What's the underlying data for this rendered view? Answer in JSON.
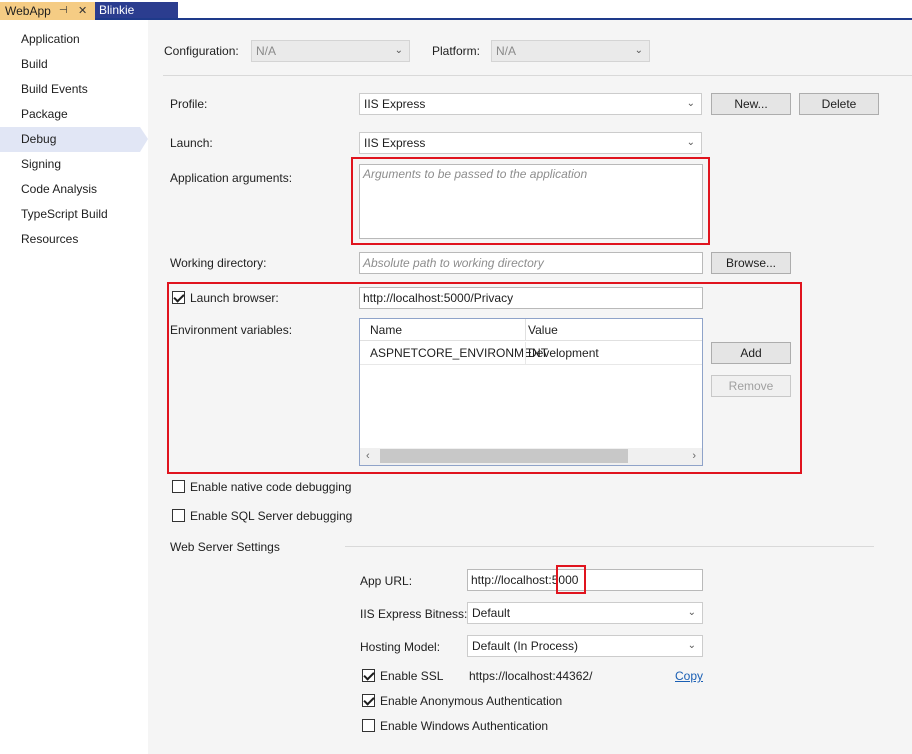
{
  "tabs": [
    {
      "label": "WebApp",
      "active": true
    },
    {
      "label": "Blinkie",
      "active": false
    }
  ],
  "sidebar": {
    "items": [
      {
        "label": "Application"
      },
      {
        "label": "Build"
      },
      {
        "label": "Build Events"
      },
      {
        "label": "Package"
      },
      {
        "label": "Debug",
        "selected": true
      },
      {
        "label": "Signing"
      },
      {
        "label": "Code Analysis"
      },
      {
        "label": "TypeScript Build"
      },
      {
        "label": "Resources"
      }
    ]
  },
  "config": {
    "configuration_label": "Configuration:",
    "configuration_value": "N/A",
    "platform_label": "Platform:",
    "platform_value": "N/A"
  },
  "profile": {
    "label": "Profile:",
    "value": "IIS Express",
    "new_label": "New...",
    "delete_label": "Delete"
  },
  "launch": {
    "label": "Launch:",
    "value": "IIS Express"
  },
  "app_args": {
    "label": "Application arguments:",
    "placeholder": "Arguments to be passed to the application"
  },
  "working_dir": {
    "label": "Working directory:",
    "placeholder": "Absolute path to working directory",
    "browse_label": "Browse..."
  },
  "launch_browser": {
    "label": "Launch browser:",
    "checked": true,
    "url": "http://localhost:5000/Privacy"
  },
  "env": {
    "label": "Environment variables:",
    "columns": [
      "Name",
      "Value"
    ],
    "rows": [
      {
        "name": "ASPNETCORE_ENVIRONMENT",
        "value": "Development"
      }
    ],
    "add_label": "Add",
    "remove_label": "Remove"
  },
  "native_debug": {
    "label": "Enable native code debugging",
    "checked": false
  },
  "sql_debug": {
    "label": "Enable SQL Server debugging",
    "checked": false
  },
  "web_server": {
    "heading": "Web Server Settings",
    "app_url_label": "App URL:",
    "app_url_prefix": "http://localhost:",
    "app_url_port": "5000",
    "bitness_label": "IIS Express Bitness:",
    "bitness_value": "Default",
    "hosting_label": "Hosting Model:",
    "hosting_value": "Default (In Process)",
    "ssl_label": "Enable SSL",
    "ssl_checked": true,
    "ssl_url": "https://localhost:44362/",
    "copy_label": "Copy",
    "anon_label": "Enable Anonymous Authentication",
    "anon_checked": true,
    "windows_label": "Enable Windows Authentication",
    "windows_checked": false
  },
  "colors": {
    "accent_red": "#e0141e",
    "tab_active": "#f5cc84",
    "tab_inactive": "#2b3d8f",
    "selection": "#e1e6f5"
  }
}
